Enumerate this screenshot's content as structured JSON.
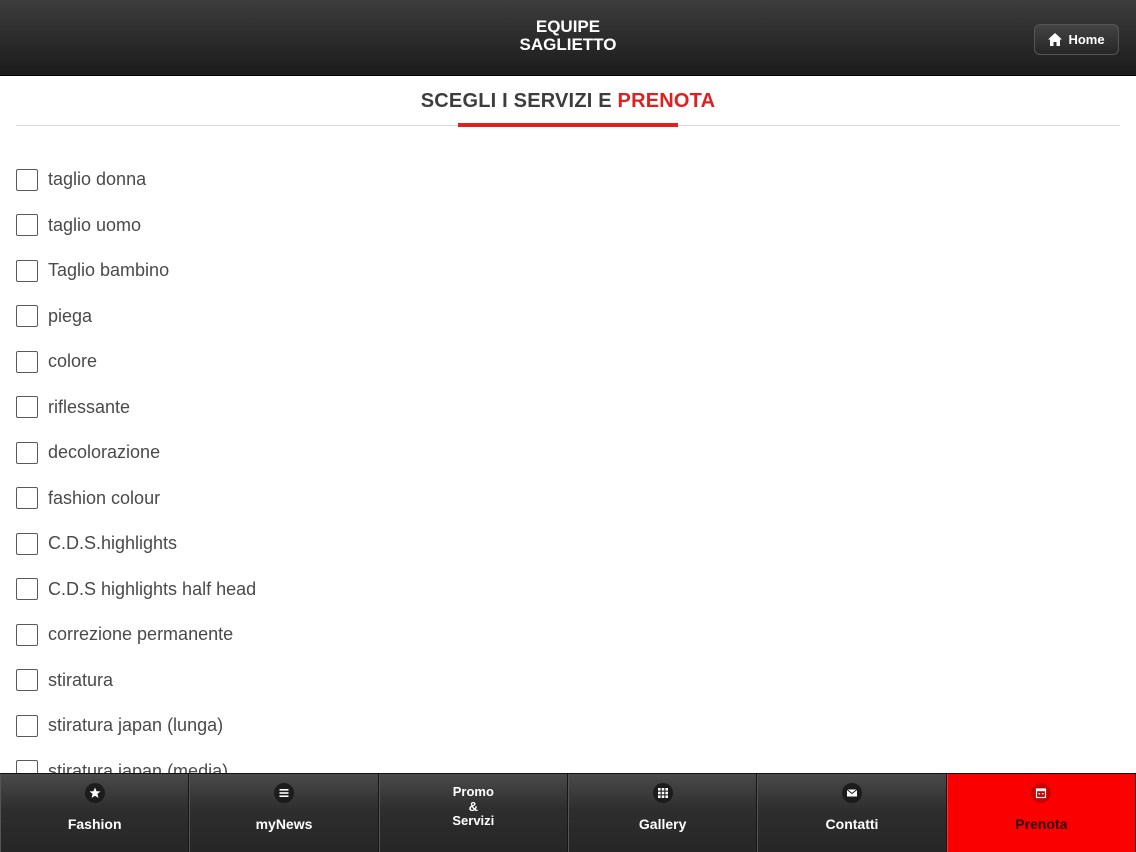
{
  "header": {
    "title_line1": "EQUIPE",
    "title_line2": "SAGLIETTO",
    "home_label": "Home"
  },
  "section": {
    "title_prefix": "SCEGLI I SERVIZI E ",
    "title_accent": "PRENOTA"
  },
  "services": [
    {
      "label": "taglio donna",
      "checked": false
    },
    {
      "label": "taglio uomo",
      "checked": false
    },
    {
      "label": "Taglio bambino",
      "checked": false
    },
    {
      "label": "piega",
      "checked": false
    },
    {
      "label": "colore",
      "checked": false
    },
    {
      "label": "riflessante",
      "checked": false
    },
    {
      "label": "decolorazione",
      "checked": false
    },
    {
      "label": "fashion colour",
      "checked": false
    },
    {
      "label": "C.D.S.highlights",
      "checked": false
    },
    {
      "label": "C.D.S highlights half head",
      "checked": false
    },
    {
      "label": "correzione permanente",
      "checked": false
    },
    {
      "label": "stiratura",
      "checked": false
    },
    {
      "label": "stiratura japan (lunga)",
      "checked": false
    },
    {
      "label": "stiratura japan (media)",
      "checked": false
    }
  ],
  "tabbar": {
    "tabs": [
      {
        "label": "Fashion",
        "icon": "star-icon"
      },
      {
        "label": "myNews",
        "icon": "list-icon"
      },
      {
        "label_lines": [
          "Promo",
          "&",
          "Servizi"
        ]
      },
      {
        "label": "Gallery",
        "icon": "grid-icon"
      },
      {
        "label": "Contatti",
        "icon": "mail-icon"
      },
      {
        "label": "Prenota",
        "icon": "calendar-icon",
        "active": true
      }
    ]
  },
  "colors": {
    "accent": "#e0201e",
    "active_tab": "#fb0000",
    "header_dark": "#1b1b1b"
  }
}
